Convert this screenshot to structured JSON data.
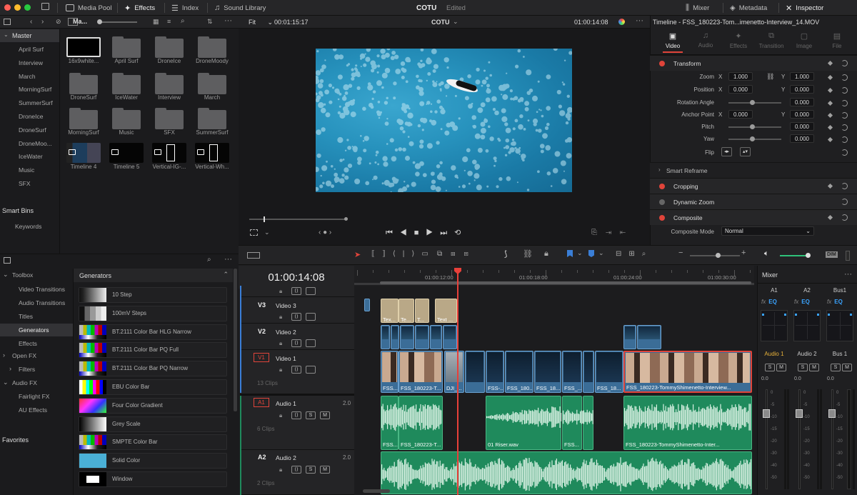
{
  "topbar": {
    "media_pool": "Media Pool",
    "effects": "Effects",
    "index": "Index",
    "sound_library": "Sound Library",
    "project": "COTU",
    "status": "Edited",
    "mixer": "Mixer",
    "metadata": "Metadata",
    "inspector": "Inspector"
  },
  "media": {
    "bin_dropdown": "Ma...",
    "master": "Master",
    "bins": [
      "April Surf",
      "Interview",
      "March",
      "MorningSurf",
      "SummerSurf",
      "DroneIce",
      "DroneSurf",
      "DroneMoo...",
      "IceWater",
      "Music",
      "SFX"
    ],
    "smart_bins": "Smart Bins",
    "keywords": "Keywords",
    "items": [
      "16x9white...",
      "April Surf",
      "DroneIce",
      "DroneMoody",
      "DroneSurf",
      "IceWater",
      "Interview",
      "March",
      "MorningSurf",
      "Music",
      "SFX",
      "SummerSurf",
      "Timeline 4",
      "Timeline 5",
      "Vertical-IG-...",
      "Vertical-Wh..."
    ]
  },
  "viewer": {
    "fit": "Fit",
    "source_tc": "00:01:15:17",
    "timeline_name": "COTU",
    "record_tc": "01:00:14:08"
  },
  "effects": {
    "toolbox": "Toolbox",
    "items": [
      "Video Transitions",
      "Audio Transitions",
      "Titles",
      "Generators",
      "Effects"
    ],
    "open_fx": "Open FX",
    "filters": "Filters",
    "audio_fx": "Audio FX",
    "fairlight_fx": "Fairlight FX",
    "au_effects": "AU Effects",
    "favorites": "Favorites",
    "generators_header": "Generators",
    "generators": [
      "10 Step",
      "100mV Steps",
      "BT.2111 Color Bar HLG Narrow",
      "BT.2111 Color Bar PQ Full",
      "BT.2111 Color Bar PQ Narrow",
      "EBU Color Bar",
      "Four Color Gradient",
      "Grey Scale",
      "SMPTE Color Bar",
      "Solid Color",
      "Window"
    ]
  },
  "timeline": {
    "timecode": "01:00:14:08",
    "ruler": [
      "01:00:12:00",
      "01:00:18:00",
      "01:00:24:00",
      "01:00:30:00"
    ],
    "v3": "V3",
    "v3_name": "Video 3",
    "v2": "V2",
    "v2_name": "Video 2",
    "v1": "V1",
    "v1_name": "Video 1",
    "v1_count": "13 Clips",
    "a1": "A1",
    "a1_name": "Audio 1",
    "a1_ch": "2.0",
    "a1_count": "6 Clips",
    "a2": "A2",
    "a2_name": "Audio 2",
    "a2_ch": "2.0",
    "a2_count": "2 Clips",
    "s": "S",
    "m": "M",
    "title_clips": [
      "Tex...",
      "Te...",
      "T...",
      "Text ..."
    ],
    "v1_clips": [
      "FSS...",
      "FSS_180223-T...",
      "DJI_...",
      "FSS-...",
      "FSS_180...",
      "FSS_18...",
      "FSS_...",
      "FSS_18...",
      "FSS_180223-TommyShimenetto-Interview..."
    ],
    "a1_clips": [
      "FSS...",
      "FSS_180223-T...",
      "01 Riser.wav",
      "FSS...",
      "FSS_180223-TommyShimenetto-Inter..."
    ]
  },
  "inspector": {
    "title": "Timeline - FSS_180223-Tom...imenetto-Interview_14.MOV",
    "tabs": [
      "Video",
      "Audio",
      "Effects",
      "Transition",
      "Image",
      "File"
    ],
    "transform": "Transform",
    "zoom": "Zoom",
    "x": "X",
    "y": "Y",
    "zoom_x": "1.000",
    "zoom_y": "1.000",
    "position": "Position",
    "pos_x": "0.000",
    "pos_y": "0.000",
    "rotation": "Rotation Angle",
    "rotation_val": "0.000",
    "anchor": "Anchor Point",
    "anchor_x": "0.000",
    "anchor_y": "0.000",
    "pitch": "Pitch",
    "pitch_val": "0.000",
    "yaw": "Yaw",
    "yaw_val": "0.000",
    "flip": "Flip",
    "smart_reframe": "Smart Reframe",
    "cropping": "Cropping",
    "dynamic_zoom": "Dynamic Zoom",
    "composite": "Composite",
    "composite_mode": "Composite Mode",
    "composite_mode_val": "Normal"
  },
  "mixer": {
    "title": "Mixer",
    "cols": [
      "A1",
      "A2",
      "Bus1"
    ],
    "fx": "fx",
    "eq": "EQ",
    "names": [
      "Audio 1",
      "Audio 2",
      "Bus 1"
    ],
    "s": "S",
    "m": "M",
    "level": "0.0",
    "scale": [
      "0",
      "-5",
      "-10",
      "-15",
      "-20",
      "-30",
      "-40",
      "-50"
    ]
  },
  "colors": {
    "playhead": "#e8403a",
    "accent": "#e0443a",
    "video_clip": "#3b6d97",
    "audio_clip": "#1f8a5c",
    "title_clip": "#b9a887"
  }
}
